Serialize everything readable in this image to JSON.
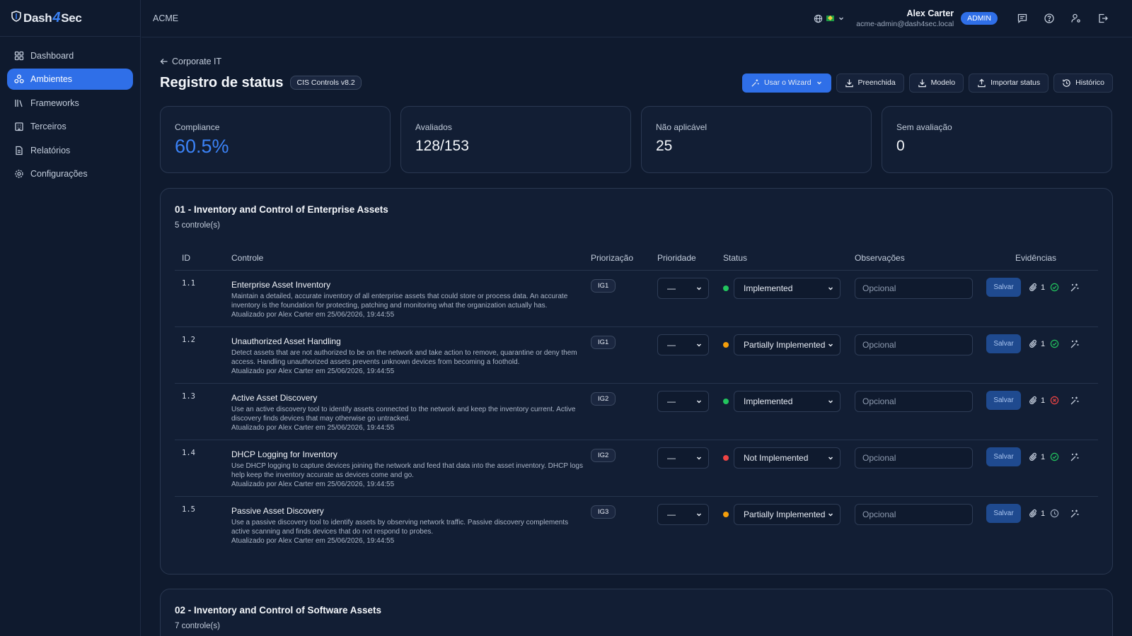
{
  "brand": {
    "name_left": "Dash",
    "name_mid": "4",
    "name_right": "Sec"
  },
  "sidebar": {
    "items": [
      {
        "label": "Dashboard",
        "icon": "grid-icon"
      },
      {
        "label": "Ambientes",
        "icon": "cubes-icon",
        "active": true
      },
      {
        "label": "Frameworks",
        "icon": "library-icon"
      },
      {
        "label": "Terceiros",
        "icon": "building-icon"
      },
      {
        "label": "Relatórios",
        "icon": "document-icon"
      },
      {
        "label": "Configurações",
        "icon": "gear-icon"
      }
    ]
  },
  "topbar": {
    "org": "ACME",
    "user_name": "Alex Carter",
    "user_email": "acme-admin@dash4sec.local",
    "role": "ADMIN"
  },
  "page": {
    "back_label": "Corporate IT",
    "title": "Registro de status",
    "framework": "CIS Controls v8.2"
  },
  "actions": {
    "wizard": "Usar o Wizard",
    "filled": "Preenchida",
    "model": "Modelo",
    "import": "Importar status",
    "history": "Histórico"
  },
  "stats": {
    "compliance_label": "Compliance",
    "compliance_value": "60.5%",
    "evaluated_label": "Avaliados",
    "evaluated_value": "128/153",
    "na_label": "Não aplicável",
    "na_value": "25",
    "none_label": "Sem avaliação",
    "none_value": "0"
  },
  "table_headers": {
    "id": "ID",
    "control": "Controle",
    "prioritization": "Priorização",
    "priority": "Prioridade",
    "status": "Status",
    "notes": "Observações",
    "evidence": "Evidências"
  },
  "section1": {
    "title": "01 - Inventory and Control of Enterprise Assets",
    "subtitle": "5 controle(s)",
    "rows": [
      {
        "id": "1.1",
        "name": "Enterprise Asset Inventory",
        "desc": "Maintain a detailed, accurate inventory of all enterprise assets that could store or process data. An accurate inventory is the foundation for protecting, patching and monitoring what the organization actually has.",
        "updated": "Atualizado por Alex Carter em 25/06/2026, 19:44:55",
        "ig": "IG1",
        "priority": "—",
        "status": "Implemented",
        "status_color": "#22c55e",
        "notes_placeholder": "Opcional",
        "save": "Salvar",
        "evidence_count": "1",
        "check": "ok"
      },
      {
        "id": "1.2",
        "name": "Unauthorized Asset Handling",
        "desc": "Detect assets that are not authorized to be on the network and take action to remove, quarantine or deny them access. Handling unauthorized assets prevents unknown devices from becoming a foothold.",
        "updated": "Atualizado por Alex Carter em 25/06/2026, 19:44:55",
        "ig": "IG1",
        "priority": "—",
        "status": "Partially Implemented",
        "status_color": "#f59e0b",
        "notes_placeholder": "Opcional",
        "save": "Salvar",
        "evidence_count": "1",
        "check": "ok"
      },
      {
        "id": "1.3",
        "name": "Active Asset Discovery",
        "desc": "Use an active discovery tool to identify assets connected to the network and keep the inventory current. Active discovery finds devices that may otherwise go untracked.",
        "updated": "Atualizado por Alex Carter em 25/06/2026, 19:44:55",
        "ig": "IG2",
        "priority": "—",
        "status": "Implemented",
        "status_color": "#22c55e",
        "notes_placeholder": "Opcional",
        "save": "Salvar",
        "evidence_count": "1",
        "check": "fail"
      },
      {
        "id": "1.4",
        "name": "DHCP Logging for Inventory",
        "desc": "Use DHCP logging to capture devices joining the network and feed that data into the asset inventory. DHCP logs help keep the inventory accurate as devices come and go.",
        "updated": "Atualizado por Alex Carter em 25/06/2026, 19:44:55",
        "ig": "IG2",
        "priority": "—",
        "status": "Not Implemented",
        "status_color": "#ef4444",
        "notes_placeholder": "Opcional",
        "save": "Salvar",
        "evidence_count": "1",
        "check": "ok"
      },
      {
        "id": "1.5",
        "name": "Passive Asset Discovery",
        "desc": "Use a passive discovery tool to identify assets by observing network traffic. Passive discovery complements active scanning and finds devices that do not respond to probes.",
        "updated": "Atualizado por Alex Carter em 25/06/2026, 19:44:55",
        "ig": "IG3",
        "priority": "—",
        "status": "Partially Implemented",
        "status_color": "#f59e0b",
        "notes_placeholder": "Opcional",
        "save": "Salvar",
        "evidence_count": "1",
        "check": "pending"
      }
    ]
  },
  "section2": {
    "title": "02 - Inventory and Control of Software Assets",
    "subtitle": "7 controle(s)"
  }
}
